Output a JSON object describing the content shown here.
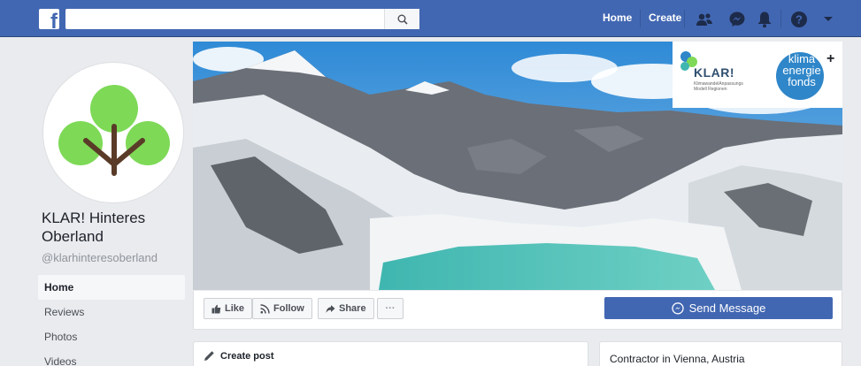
{
  "header": {
    "search_placeholder": "",
    "home": "Home",
    "create": "Create",
    "icons": [
      "facebook-logo",
      "search-icon",
      "friends-icon",
      "messenger-icon",
      "notifications-icon",
      "help-icon",
      "dropdown-icon"
    ]
  },
  "page": {
    "name": "KLAR! Hinteres Oberland",
    "handle": "@klarhinteresoberland"
  },
  "sidebar": {
    "items": [
      {
        "label": "Home",
        "active": true
      },
      {
        "label": "Reviews"
      },
      {
        "label": "Photos"
      },
      {
        "label": "Videos"
      }
    ]
  },
  "cover": {
    "logos": {
      "klar_title": "KLAR!",
      "klar_subtitle": "KlimawandelAnpassungs Modell Regionen",
      "klima_text_1": "klima",
      "klima_text_2": "energie",
      "klima_text_3": "fonds",
      "klima_plus": "+"
    }
  },
  "actions": {
    "like": "Like",
    "follow": "Follow",
    "share": "Share",
    "more": "···",
    "send_message": "Send Message"
  },
  "cards": {
    "create_post": "Create post",
    "info": "Contractor in Vienna, Austria"
  },
  "colors": {
    "brand": "#4267b2",
    "background": "#e9ebee",
    "tree_green": "#7ed957",
    "lake": "#3fb6b0"
  }
}
